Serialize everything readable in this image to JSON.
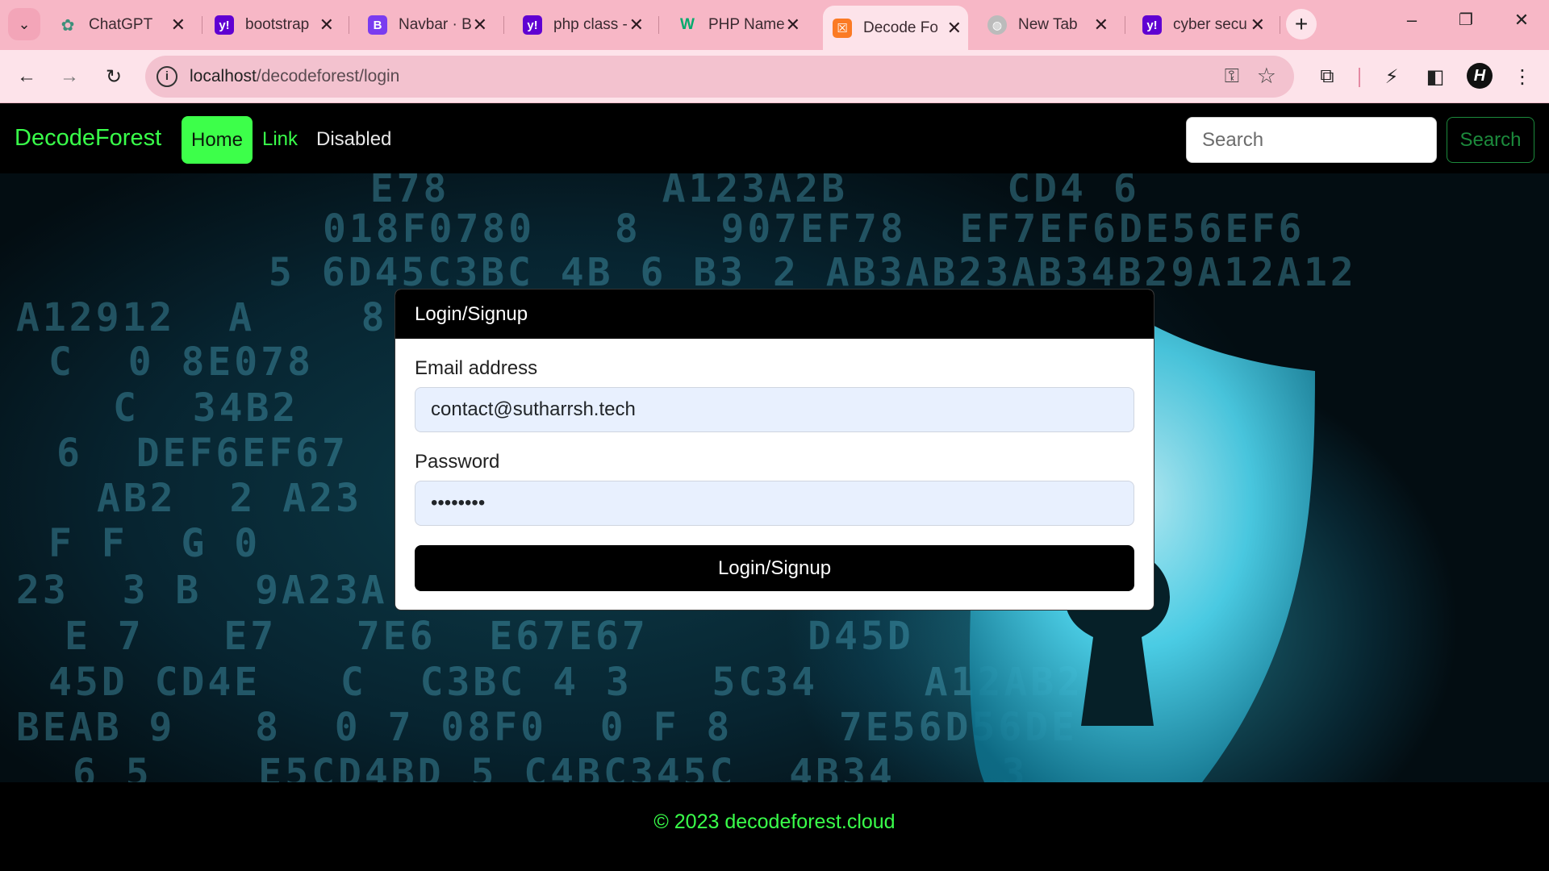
{
  "browser": {
    "tabs": [
      {
        "title": "ChatGPT",
        "icon": "chatgpt-icon"
      },
      {
        "title": "bootstrap",
        "icon": "yahoo-icon"
      },
      {
        "title": "Navbar · B",
        "icon": "bootstrap-icon"
      },
      {
        "title": "php class -",
        "icon": "yahoo-icon"
      },
      {
        "title": "PHP Name",
        "icon": "w3schools-icon"
      },
      {
        "title": "Decode Fo",
        "icon": "xampp-icon",
        "active": true
      },
      {
        "title": "New Tab",
        "icon": "globe-icon"
      },
      {
        "title": "cyber secu",
        "icon": "yahoo-icon"
      }
    ],
    "url_host": "localhost",
    "url_path": "/decodeforest/login",
    "profile_initial": "H",
    "colors": {
      "tabbar": "#f7b7c6",
      "toolbar": "#fde3ea"
    }
  },
  "nav": {
    "brand": "DecodeForest",
    "home": "Home",
    "link": "Link",
    "disabled": "Disabled",
    "search_placeholder": "Search",
    "search_button": "Search",
    "accent": "#39ff4a"
  },
  "login": {
    "header": "Login/Signup",
    "email_label": "Email address",
    "email_value": "contact@sutharrsh.tech",
    "password_label": "Password",
    "password_value": "password",
    "submit": "Login/Signup"
  },
  "footer": {
    "text": "© 2023 decodeforest.cloud"
  }
}
